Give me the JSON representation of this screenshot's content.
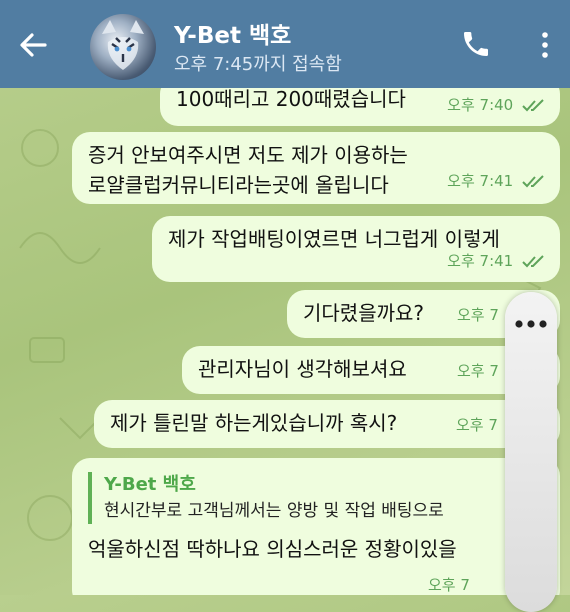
{
  "header": {
    "title": "Y-Bet 백호",
    "status": "오후 7:45까지 접속함"
  },
  "messages": [
    {
      "text": "100때리고 200때렸습니다",
      "time": "오후 7:40"
    },
    {
      "text_line1": "증거 안보여주시면 저도 제가 이용하는",
      "text_line2": "로얄클럽커뮤니티라는곳에 올립니다",
      "time": "오후 7:41"
    },
    {
      "text": "제가 작업배팅이였르면 너그럽게 이렇게",
      "time": "오후 7:41"
    },
    {
      "text": "기다렸을까요?",
      "time": "오후 7"
    },
    {
      "text": "관리자님이 생각해보셔요",
      "time": "오후 7"
    },
    {
      "text": "제가 틀린말 하는게있습니까 혹시?",
      "time": "오후 7"
    },
    {
      "reply_name": "Y-Bet 백호",
      "reply_text": "현시간부로 고객님께서는 양방 및 작업 배팅으로",
      "text": "억울하신점 딱하나요 의심스러운 정황이있을",
      "time": "오후 7"
    }
  ],
  "icons": {
    "back": "arrow-left-icon",
    "call": "phone-icon",
    "menu": "more-vertical-icon",
    "read": "double-check-icon",
    "scroll": "ellipsis-icon"
  }
}
